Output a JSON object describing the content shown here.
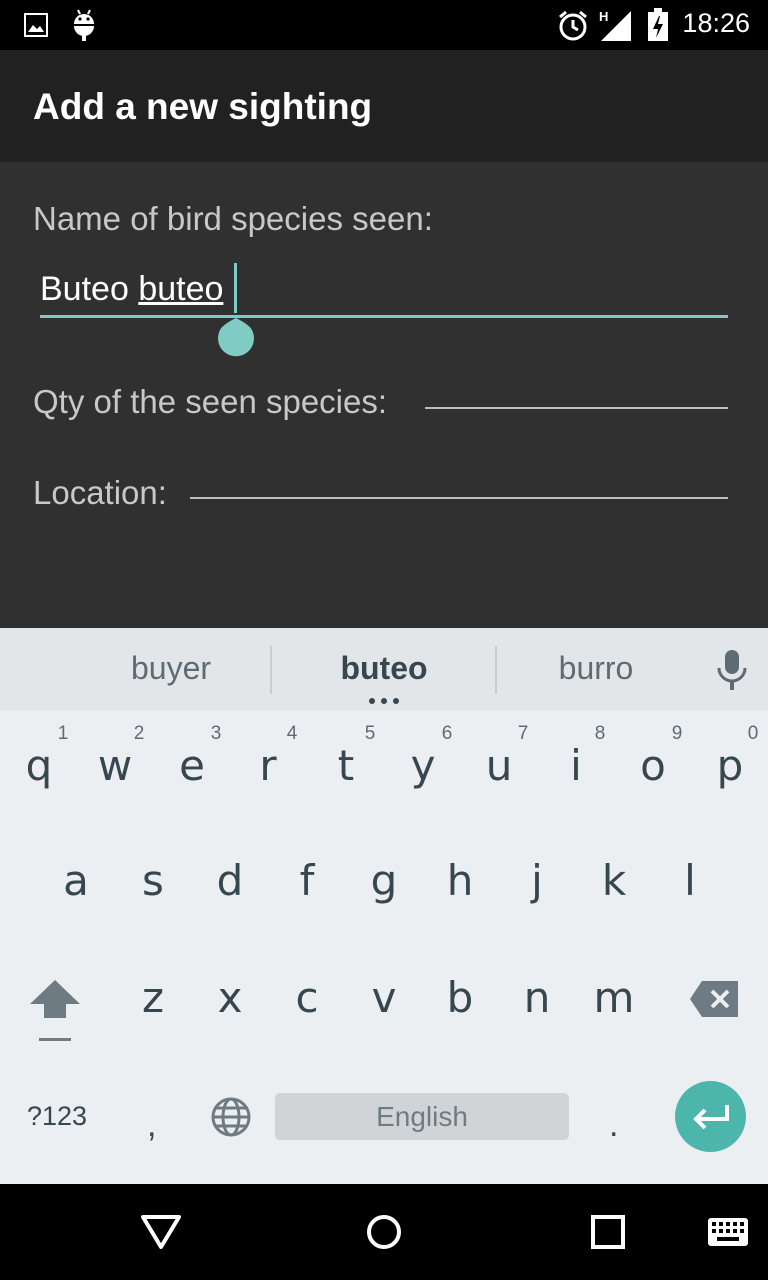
{
  "status_bar": {
    "time": "18:26",
    "left_icons": [
      "image-icon",
      "android-icon"
    ],
    "right_icons": [
      "alarm-icon",
      "signal-icon",
      "battery-icon"
    ],
    "network_label": "H"
  },
  "app_bar": {
    "title": "Add a new sighting"
  },
  "form": {
    "species_label": "Name of bird species seen:",
    "species_value_plain": "Buteo ",
    "species_value_composing": "buteo",
    "qty_label": "Qty of the seen species:",
    "location_label": "Location:",
    "accent_color": "#80cbc4"
  },
  "keyboard": {
    "suggestions": [
      "buyer",
      "buteo",
      "burro"
    ],
    "row1": [
      {
        "key": "q",
        "hint": "1"
      },
      {
        "key": "w",
        "hint": "2"
      },
      {
        "key": "e",
        "hint": "3"
      },
      {
        "key": "r",
        "hint": "4"
      },
      {
        "key": "t",
        "hint": "5"
      },
      {
        "key": "y",
        "hint": "6"
      },
      {
        "key": "u",
        "hint": "7"
      },
      {
        "key": "i",
        "hint": "8"
      },
      {
        "key": "o",
        "hint": "9"
      },
      {
        "key": "p",
        "hint": "0"
      }
    ],
    "row2": [
      "a",
      "s",
      "d",
      "f",
      "g",
      "h",
      "j",
      "k",
      "l"
    ],
    "row3": [
      "z",
      "x",
      "c",
      "v",
      "b",
      "n",
      "m"
    ],
    "symbols_key": "?123",
    "comma_key": ",",
    "period_key": ".",
    "space_label": "English",
    "enter_color": "#4db6ac"
  },
  "nav_bar": {
    "icons": [
      "back-icon",
      "home-icon",
      "recents-icon",
      "keyboard-icon"
    ]
  }
}
